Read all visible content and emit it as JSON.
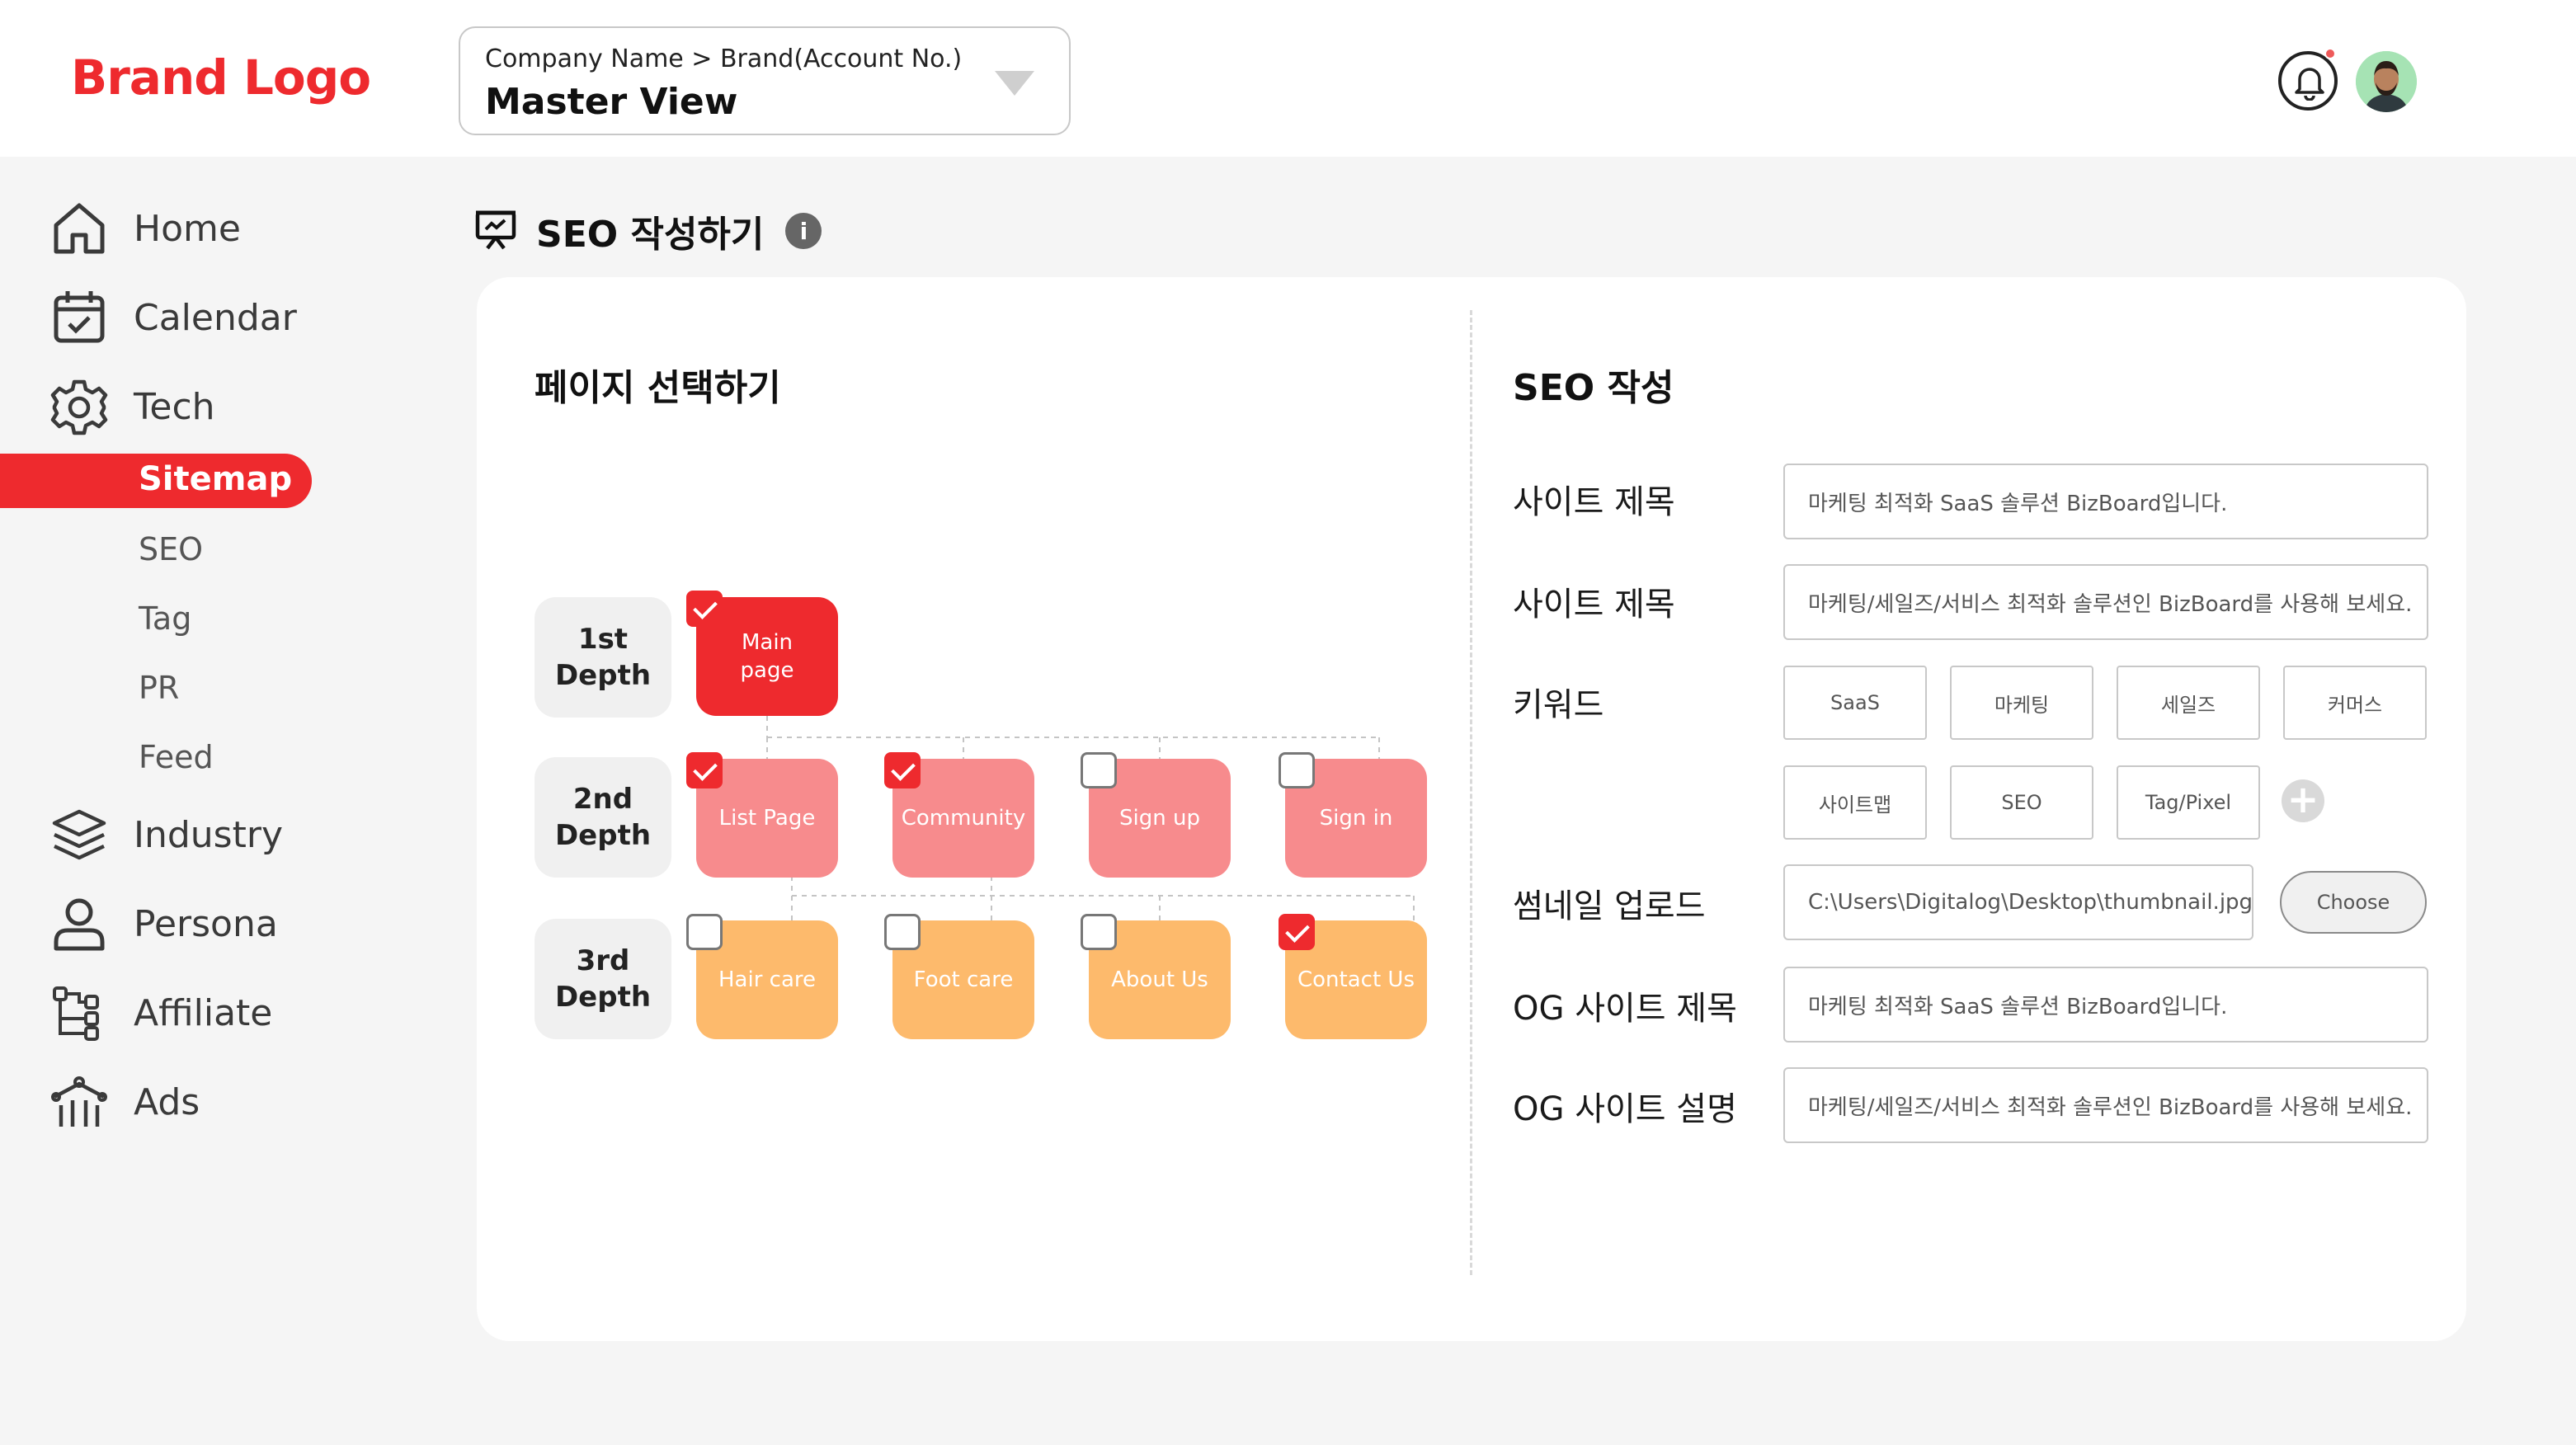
{
  "header": {
    "brand_logo": "Brand Logo",
    "account_path": "Company Name > Brand(Account No.)",
    "account_view": "Master View"
  },
  "sidebar": {
    "items": [
      {
        "label": "Home",
        "icon": "home-icon"
      },
      {
        "label": "Calendar",
        "icon": "calendar-check-icon"
      },
      {
        "label": "Tech",
        "icon": "gear-icon"
      },
      {
        "label": "Industry",
        "icon": "layers-icon"
      },
      {
        "label": "Persona",
        "icon": "user-icon"
      },
      {
        "label": "Affiliate",
        "icon": "tree-structure-icon"
      },
      {
        "label": "Ads",
        "icon": "megaphone-icon"
      }
    ],
    "tech_sub": [
      {
        "label": "Sitemap",
        "active": true
      },
      {
        "label": "SEO"
      },
      {
        "label": "Tag"
      },
      {
        "label": "PR"
      },
      {
        "label": "Feed"
      }
    ]
  },
  "page": {
    "title": "SEO 작성하기",
    "title_icon": "presentation-icon",
    "info_icon": "i"
  },
  "sitemap": {
    "title": "페이지 선택하기",
    "depths": [
      "1st\nDepth",
      "2nd\nDepth",
      "3rd\nDepth"
    ],
    "depth1": [
      {
        "label": "Main\npage",
        "checked": true
      }
    ],
    "depth2": [
      {
        "label": "List Page",
        "checked": true
      },
      {
        "label": "Community",
        "checked": true
      },
      {
        "label": "Sign up",
        "checked": false
      },
      {
        "label": "Sign in",
        "checked": false
      }
    ],
    "depth3": [
      {
        "label": "Hair care",
        "checked": false
      },
      {
        "label": "Foot care",
        "checked": false
      },
      {
        "label": "About Us",
        "checked": false
      },
      {
        "label": "Contact Us",
        "checked": true
      }
    ]
  },
  "seo": {
    "title": "SEO 작성",
    "site_title_label": "사이트 제목",
    "site_title_value": "마케팅 최적화 SaaS 솔루션 BizBoard입니다.",
    "site_desc_label": "사이트 제목",
    "site_desc_value": "마케팅/세일즈/서비스 최적화 솔루션인 BizBoard를 사용해 보세요.",
    "keywords_label": "키워드",
    "keywords": [
      "SaaS",
      "마케팅",
      "세일즈",
      "커머스",
      "사이트맵",
      "SEO",
      "Tag/Pixel"
    ],
    "thumbnail_label": "썸네일 업로드",
    "thumbnail_path": "C:\\Users\\Digitalog\\Desktop\\thumbnail.jpg",
    "choose_label": "Choose",
    "og_title_label": "OG 사이트 제목",
    "og_title_value": "마케팅 최적화 SaaS 솔루션 BizBoard입니다.",
    "og_desc_label": "OG 사이트 설명",
    "og_desc_value": "마케팅/세일즈/서비스 최적화 솔루션인 BizBoard를 사용해 보세요."
  },
  "colors": {
    "brand": "#ee2a2e",
    "depth1": "#ee2a2e",
    "depth2": "#f78b8d",
    "depth3": "#fdba6c"
  }
}
